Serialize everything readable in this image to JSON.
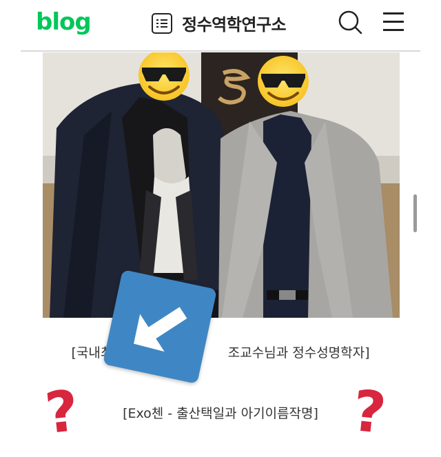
{
  "header": {
    "logo": "blog",
    "blog_title": "정수역학연구소"
  },
  "post": {
    "caption_left": "[국내최고",
    "caption_right": "조교수님과 정수성명학자]",
    "caption2": "[Exo첸 - 출산택일과 아기이름작명]"
  },
  "decorations": {
    "question_mark_left": "?",
    "question_mark_right": "?"
  },
  "colors": {
    "brand_green": "#03c75a",
    "badge_blue": "#3f87c4",
    "question_red": "#d7263d"
  }
}
